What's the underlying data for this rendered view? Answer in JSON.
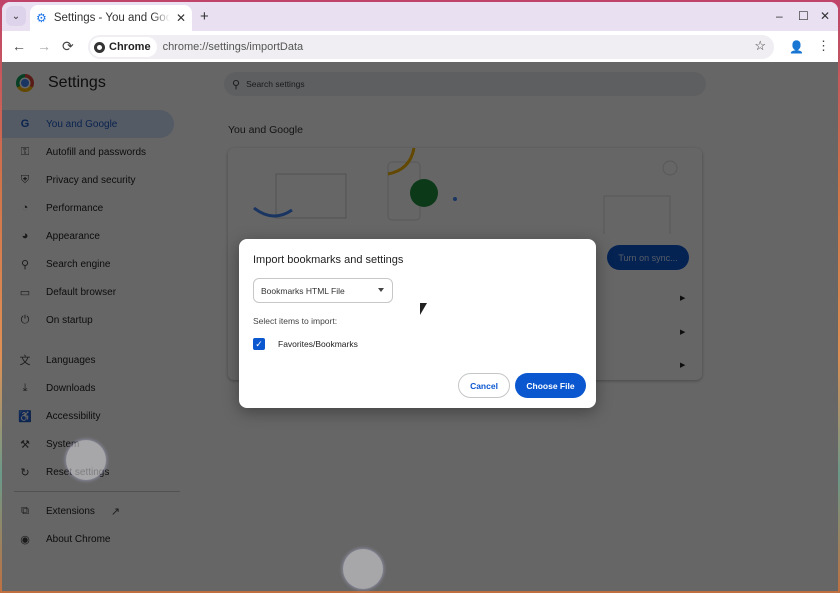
{
  "browser": {
    "tab": {
      "title": "Settings - You and Google",
      "favicon": "gear-icon"
    },
    "new_tab_label": "+",
    "window_controls": {
      "minimize": "–",
      "maximize": "☐",
      "close": "✕"
    },
    "toolbar": {
      "back": "←",
      "forward": "→",
      "reload": "⟳",
      "site_chip": "Chrome",
      "url": "chrome://settings/importData",
      "bookmark_star": "☆",
      "menu": "⋮"
    }
  },
  "settings": {
    "title": "Settings",
    "search_placeholder": "Search settings",
    "sidebar": {
      "items": [
        {
          "label": "You and Google",
          "icon": "google-g-icon",
          "glyph": "G",
          "active": true
        },
        {
          "label": "Autofill and passwords",
          "icon": "key-icon",
          "glyph": "⚿"
        },
        {
          "label": "Privacy and security",
          "icon": "shield-icon",
          "glyph": "⛨"
        },
        {
          "label": "Performance",
          "icon": "speedometer-icon",
          "glyph": "◔"
        },
        {
          "label": "Appearance",
          "icon": "palette-icon",
          "glyph": "◕"
        },
        {
          "label": "Search engine",
          "icon": "search-icon",
          "glyph": "⚲"
        },
        {
          "label": "Default browser",
          "icon": "browser-window-icon",
          "glyph": "▭"
        },
        {
          "label": "On startup",
          "icon": "power-icon",
          "glyph": "⏻"
        },
        {
          "label": "Languages",
          "icon": "translate-icon",
          "glyph": "文"
        },
        {
          "label": "Downloads",
          "icon": "download-icon",
          "glyph": "⤓"
        },
        {
          "label": "Accessibility",
          "icon": "accessibility-icon",
          "glyph": "♿"
        },
        {
          "label": "System",
          "icon": "wrench-icon",
          "glyph": "⚒"
        },
        {
          "label": "Reset settings",
          "icon": "reset-icon",
          "glyph": "↻"
        },
        {
          "label": "Extensions",
          "icon": "puzzle-icon",
          "glyph": "⧉",
          "external": "↗"
        },
        {
          "label": "About Chrome",
          "icon": "chrome-icon",
          "glyph": "◉"
        }
      ]
    },
    "main": {
      "section_title": "You and Google",
      "sync_button": "Turn on sync..."
    }
  },
  "dialog": {
    "title": "Import bookmarks and settings",
    "source_select": "Bookmarks HTML File",
    "items_label": "Select items to import:",
    "checkbox": {
      "label": "Favorites/Bookmarks",
      "checked": true
    },
    "cancel_label": "Cancel",
    "choose_label": "Choose File"
  }
}
